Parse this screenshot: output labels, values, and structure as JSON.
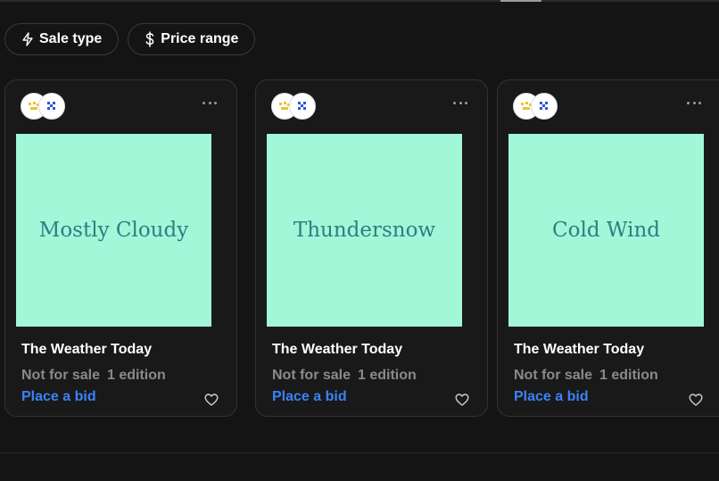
{
  "filters": [
    {
      "label": "Sale type",
      "icon": "lightning-icon"
    },
    {
      "label": "Price range",
      "icon": "dollar-icon"
    }
  ],
  "colors": {
    "background": "#141414",
    "card_background": "#191919",
    "art_background": "#a1f7d7",
    "art_text": "#2f7e83",
    "link": "#3b82f6",
    "muted": "#8a8a8a"
  },
  "cards": [
    {
      "art_text": "Mostly Cloudy",
      "title": "The Weather Today",
      "status": "Not for sale",
      "editions": "1 edition",
      "action": "Place a bid"
    },
    {
      "art_text": "Thundersnow",
      "title": "The Weather Today",
      "status": "Not for sale",
      "editions": "1 edition",
      "action": "Place a bid"
    },
    {
      "art_text": "Cold Wind",
      "title": "The Weather Today",
      "status": "Not for sale",
      "editions": "1 edition",
      "action": "Place a bid"
    }
  ]
}
